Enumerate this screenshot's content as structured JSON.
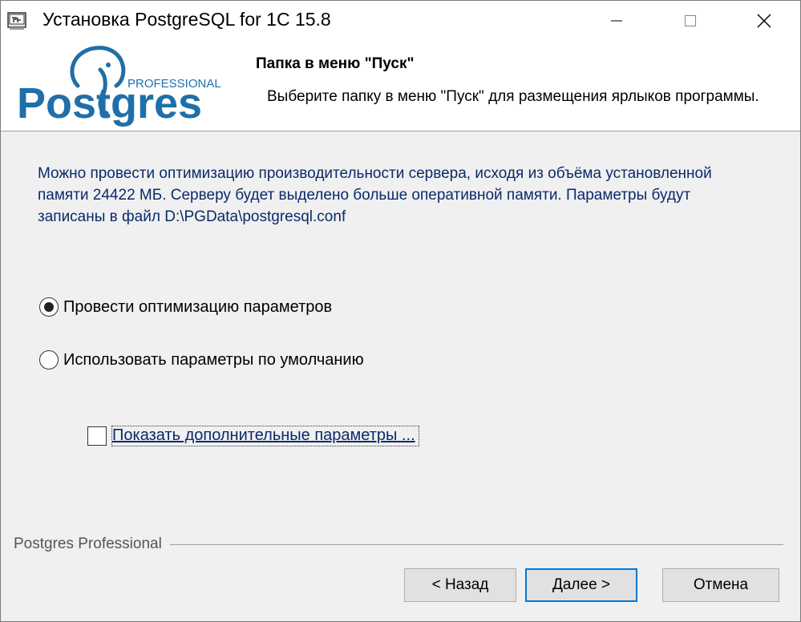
{
  "window": {
    "title": "Установка PostgreSQL for 1C 15.8",
    "controls": {
      "minimize_icon": "minimize-icon",
      "maximize_icon": "maximize-icon",
      "close_icon": "close-icon"
    }
  },
  "header": {
    "logo_brand": "Postgres",
    "logo_tag": "PROFESSIONAL",
    "title": "Папка в меню \"Пуск\"",
    "description": "Выберите папку в меню \"Пуск\" для размещения ярлыков программы."
  },
  "body": {
    "info": "Можно провести оптимизацию производительности сервера, исходя из объёма установленной памяти 24422 МБ. Серверу будет выделено больше оперативной памяти. Параметры будут записаны в файл D:\\PGData\\postgresql.conf",
    "options": [
      {
        "label": "Провести оптимизацию параметров",
        "selected": true
      },
      {
        "label": "Использовать параметры по умолчанию",
        "selected": false
      }
    ],
    "show_advanced": {
      "label": "Показать дополнительные параметры ...",
      "checked": false
    }
  },
  "footer": {
    "brand": "Postgres Professional",
    "back_label": "< Назад",
    "next_label": "Далее >",
    "cancel_label": "Отмена"
  },
  "colors": {
    "logo_blue": "#1f6fa8",
    "info_text": "#0b2a6a",
    "focus_border": "#0078d7"
  }
}
